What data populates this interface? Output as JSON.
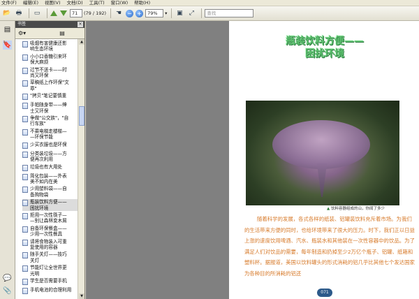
{
  "menu": [
    "文件(F)",
    "编辑(E)",
    "视图(V)",
    "文档(D)",
    "工具(T)",
    "窗口(W)",
    "帮助(H)"
  ],
  "toolbar": {
    "page_current": "71",
    "page_total": "(79 / 192)",
    "zoom_value": "79%",
    "search_placeholder": "查找"
  },
  "panel": {
    "title": "书签",
    "close": "×"
  },
  "bookmarks": [
    "吸烟有害健康还影\n响生态环境",
    "小小口香糖引来环\n保大麻烦",
    "过节不送卡——时\n尚又环保",
    "草稿纸上作环保\"文\n章\"",
    "\"拷贝\"笔记要慎重",
    "手帕随身带——绅\n士又环保",
    "争做\"公交族\"，\"自\n行车族\"",
    "不乘电梯走楼梯—\n—环保节能",
    "少买衣服也是环保",
    "分类装垃圾——方\n便再次利用",
    "垃圾也有大用处",
    "简化包装——外表\n美不如内在美",
    "少用塑料袋——自\n备购物袋",
    "瓶装饮料方便——\n困扰环境",
    "拒用一次性筷子—\n—别让森林变木屑",
    "自备环保餐盒——\n少用一次性餐具",
    "请将食物装入可重\n复使用的容器",
    "随手关灯——技巧\n关灯",
    "节能灯让全世界更\n光明",
    "学生是否需要手机",
    "手机电池的合理利用"
  ],
  "selected_index": 13,
  "document": {
    "title_line1": "瓶装饮料方便——",
    "title_line2": "困扰环境",
    "caption": "饮料容器组成的山，你闻了多少",
    "body": "随着科学的发展，各式各样的纸装、铝罐装饮料充斥着市场。为我们的生活带来方便的同时，也给环境带来了很大的压力。时下，我们正以日益上涨的速度饮用啤酒、汽水、瓶装水和其他装在一次性容器中的饮品。为了满足人们对饮品的需要，每年制造和扔掉至少2万亿个瓶子、铝罐、纸箱和塑料杯。据报道，美国以饮料罐头的形式消耗的铝几乎比其他七个发达国家为各种目的所消耗的铝还",
    "page_number": "071"
  }
}
